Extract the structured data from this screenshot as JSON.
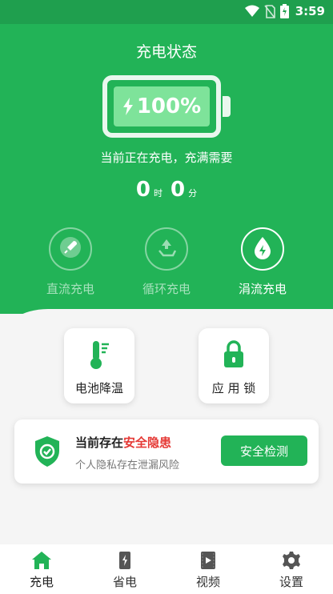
{
  "status_bar": {
    "time": "3:59"
  },
  "header": {
    "title": "充电状态"
  },
  "battery": {
    "percent_text": "100%",
    "level": 1.0
  },
  "charge": {
    "message": "当前正在充电，充满需要",
    "hours": "0",
    "hours_unit": "时",
    "minutes": "0",
    "minutes_unit": "分"
  },
  "modes": [
    {
      "label": "直流充电",
      "icon": "rocket-icon",
      "active": false
    },
    {
      "label": "循环充电",
      "icon": "recycle-icon",
      "active": false
    },
    {
      "label": "涓流充电",
      "icon": "drop-icon",
      "active": true
    }
  ],
  "tools": [
    {
      "label": "电池降温",
      "icon": "thermometer-icon"
    },
    {
      "label": "应 用 锁",
      "icon": "lock-icon"
    }
  ],
  "security": {
    "title_prefix": "当前存在",
    "title_warning": "安全隐患",
    "subtitle": "个人隐私存在泄漏风险",
    "button_label": "安全检测"
  },
  "nav": [
    {
      "label": "充电",
      "icon": "home-icon",
      "active": true
    },
    {
      "label": "省电",
      "icon": "battery-save-icon",
      "active": false
    },
    {
      "label": "视频",
      "icon": "video-icon",
      "active": false
    },
    {
      "label": "设置",
      "icon": "gear-icon",
      "active": false
    }
  ],
  "colors": {
    "primary": "#22b357",
    "warning": "#e53935",
    "battery_fill": "#7ee39a"
  }
}
